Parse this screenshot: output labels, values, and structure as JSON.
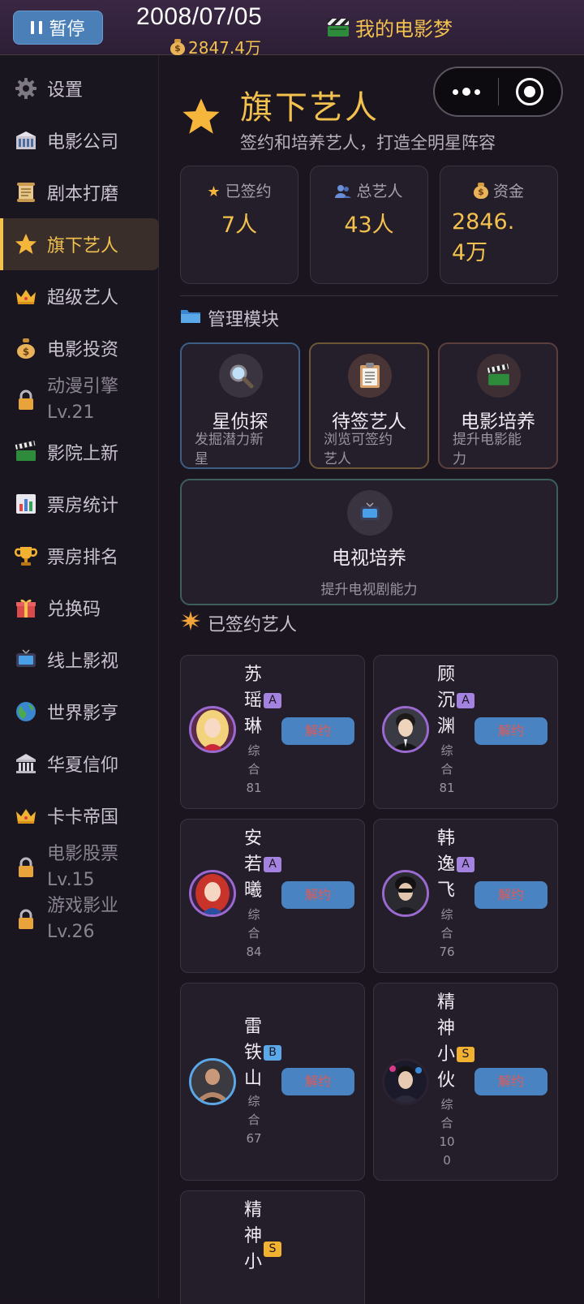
{
  "topbar": {
    "pause_label": "暂停",
    "date": "2008/07/05",
    "money": "2847.4万",
    "title": "我的电影梦"
  },
  "sidebar": {
    "items": [
      {
        "label": "设置",
        "icon": "gear-icon"
      },
      {
        "label": "电影公司",
        "icon": "company-building-icon"
      },
      {
        "label": "剧本打磨",
        "icon": "scroll-icon"
      },
      {
        "label": "旗下艺人",
        "icon": "star-icon",
        "active": true
      },
      {
        "label": "超级艺人",
        "icon": "crown-icon"
      },
      {
        "label": "电影投资",
        "icon": "money-bag-icon"
      },
      {
        "label": "动漫引擎",
        "level": "Lv.21",
        "icon": "lock-icon",
        "locked": true
      },
      {
        "label": "影院上新",
        "icon": "clapperboard-icon"
      },
      {
        "label": "票房统计",
        "icon": "bar-chart-icon"
      },
      {
        "label": "票房排名",
        "icon": "trophy-icon"
      },
      {
        "label": "兑换码",
        "icon": "gift-icon"
      },
      {
        "label": "线上影视",
        "icon": "tv-icon"
      },
      {
        "label": "世界影亨",
        "icon": "globe-icon"
      },
      {
        "label": "华夏信仰",
        "icon": "temple-icon"
      },
      {
        "label": "卡卡帝国",
        "icon": "crown-icon"
      },
      {
        "label": "电影股票",
        "level": "Lv.15",
        "icon": "lock-icon",
        "locked": true
      },
      {
        "label": "游戏影业",
        "level": "Lv.26",
        "icon": "lock-icon",
        "locked": true
      }
    ]
  },
  "header": {
    "title": "旗下艺人",
    "subtitle": "签约和培养艺人，打造全明星阵容"
  },
  "stats": [
    {
      "label": "已签约",
      "value": "7人",
      "icon": "star-icon"
    },
    {
      "label": "总艺人",
      "value": "43人",
      "icon": "people-icon"
    },
    {
      "label": "资金",
      "value": "2846.4万",
      "value_line1": "2846.",
      "value_line2": "4万",
      "icon": "money-bag-icon"
    }
  ],
  "modules_title": "管理模块",
  "modules": [
    {
      "title": "星侦探",
      "desc": "发掘潜力新星",
      "desc_line1": "发掘潜力新",
      "desc_line2": "星",
      "icon": "magnifier-icon"
    },
    {
      "title": "待签艺人",
      "desc": "浏览可签约艺人",
      "desc_line1": "浏览可签约",
      "desc_line2": "艺人",
      "icon": "clipboard-icon"
    },
    {
      "title": "电影培养",
      "desc": "提升电影能力",
      "desc_line1": "提升电影能",
      "desc_line2": "力",
      "icon": "clapperboard-icon"
    },
    {
      "title": "电视培养",
      "desc": "提升电视剧能力",
      "icon": "tv-icon"
    }
  ],
  "signed_title": "已签约艺人",
  "terminate_label": "解约",
  "artists": [
    {
      "name": "苏瑶琳",
      "rank": "A",
      "score_label": "综合",
      "score": "81"
    },
    {
      "name": "顾沉渊",
      "rank": "A",
      "score_label": "综合",
      "score": "81"
    },
    {
      "name": "安若曦",
      "rank": "A",
      "score_label": "综合",
      "score": "84"
    },
    {
      "name": "韩逸飞",
      "rank": "A",
      "score_label": "综合",
      "score": "76"
    },
    {
      "name": "雷铁山",
      "rank": "B",
      "score_label": "综合",
      "score": "67"
    },
    {
      "name": "精神小伙",
      "rank": "S",
      "score_label": "综合",
      "score": "100"
    },
    {
      "name": "精神小",
      "rank": "S"
    }
  ]
}
